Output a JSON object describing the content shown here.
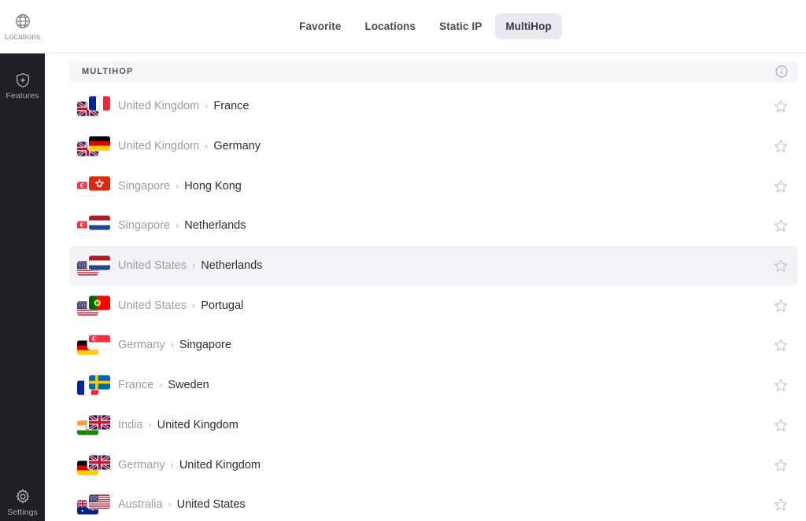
{
  "colors": {
    "sidebar_bg": "#1f1f26",
    "accent_row_hover": "#f3f2f6",
    "header_bg": "#f5f5f8",
    "tab_active_bg": "#e9e9ef",
    "text_muted": "#9d9da6",
    "text_strong": "#2d2d36"
  },
  "sidebar": {
    "items": [
      {
        "label": "Locations",
        "icon": "globe-icon",
        "active": true
      },
      {
        "label": "Features",
        "icon": "shield-plus-icon",
        "active": false
      },
      {
        "label": "Settings",
        "icon": "gear-icon",
        "active": false
      }
    ]
  },
  "topnav": {
    "tabs": [
      {
        "label": "Favorite",
        "active": false
      },
      {
        "label": "Locations",
        "active": false
      },
      {
        "label": "Static IP",
        "active": false
      },
      {
        "label": "MultiHop",
        "active": true
      }
    ]
  },
  "list": {
    "header_title": "MULTIHOP",
    "info_icon": "info-circle-icon",
    "favorite_icon": "star-outline-icon",
    "separator": "›",
    "rows": [
      {
        "from": "United Kingdom",
        "to": "France",
        "from_flag": "gb",
        "to_flag": "fr",
        "hover": false,
        "favorited": false
      },
      {
        "from": "United Kingdom",
        "to": "Germany",
        "from_flag": "gb",
        "to_flag": "de",
        "hover": false,
        "favorited": false
      },
      {
        "from": "Singapore",
        "to": "Hong Kong",
        "from_flag": "sg",
        "to_flag": "hk",
        "hover": false,
        "favorited": false
      },
      {
        "from": "Singapore",
        "to": "Netherlands",
        "from_flag": "sg",
        "to_flag": "nl",
        "hover": false,
        "favorited": false
      },
      {
        "from": "United States",
        "to": "Netherlands",
        "from_flag": "us",
        "to_flag": "nl",
        "hover": true,
        "favorited": false
      },
      {
        "from": "United States",
        "to": "Portugal",
        "from_flag": "us",
        "to_flag": "pt",
        "hover": false,
        "favorited": false
      },
      {
        "from": "Germany",
        "to": "Singapore",
        "from_flag": "de",
        "to_flag": "sg",
        "hover": false,
        "favorited": false
      },
      {
        "from": "France",
        "to": "Sweden",
        "from_flag": "fr",
        "to_flag": "se",
        "hover": false,
        "favorited": false
      },
      {
        "from": "India",
        "to": "United Kingdom",
        "from_flag": "in",
        "to_flag": "gb",
        "hover": false,
        "favorited": false
      },
      {
        "from": "Germany",
        "to": "United Kingdom",
        "from_flag": "de",
        "to_flag": "gb",
        "hover": false,
        "favorited": false
      },
      {
        "from": "Australia",
        "to": "United States",
        "from_flag": "au",
        "to_flag": "us",
        "hover": false,
        "favorited": false
      }
    ]
  }
}
